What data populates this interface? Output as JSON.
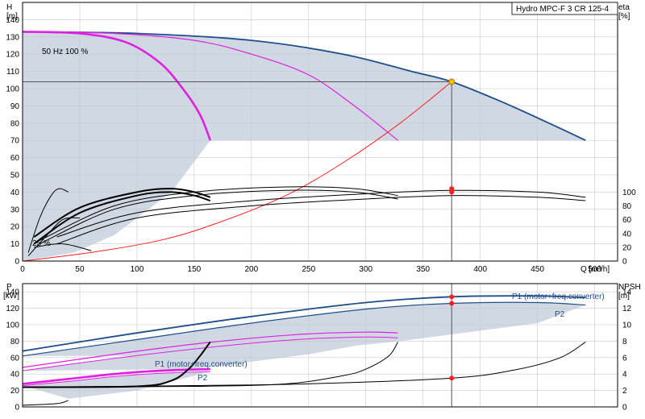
{
  "title": "Hydro MPC-F 3 CR 125-4",
  "colors": {
    "area_fill": "#cfd8e3",
    "grid": "#c8c8c8",
    "blue_curve": "#1f4e8c",
    "magenta": "#e020e0",
    "red": "#ff2020",
    "black": "#000000",
    "duty_point_fill": "#f5c000"
  },
  "chart_data": [
    {
      "id": "head-efficiency",
      "type": "line",
      "xlabel": "Q [m³/h]",
      "ylabel_left": "H\n[m]",
      "ylabel_right": "eta\n[%]",
      "xlim": [
        0,
        520
      ],
      "ylim_left": [
        0,
        150
      ],
      "ylim_right": [
        0,
        150
      ],
      "x_ticks": [
        0,
        50,
        100,
        150,
        200,
        250,
        300,
        350,
        400,
        450,
        500
      ],
      "y_ticks_left": [
        0,
        10,
        20,
        30,
        40,
        50,
        60,
        70,
        80,
        90,
        100,
        110,
        120,
        130,
        140
      ],
      "y_ticks_right": [
        0,
        20,
        40,
        60,
        80,
        100
      ],
      "annotations": [
        "50 Hz 100 %",
        "25 %"
      ],
      "duty_point": {
        "q": 375,
        "h": 104
      },
      "series": [
        {
          "key": "h3",
          "style": "blue",
          "points": [
            [
              0,
              133
            ],
            [
              100,
              132
            ],
            [
              200,
              128
            ],
            [
              280,
              120
            ],
            [
              340,
              110
            ],
            [
              375,
              104
            ],
            [
              420,
              92
            ],
            [
              460,
              80
            ],
            [
              492,
              70
            ]
          ]
        },
        {
          "key": "h2",
          "style": "magenta",
          "points": [
            [
              0,
              133
            ],
            [
              80,
              132
            ],
            [
              150,
              128
            ],
            [
              200,
              120
            ],
            [
              250,
              108
            ],
            [
              290,
              90
            ],
            [
              328,
              70
            ]
          ]
        },
        {
          "key": "h1",
          "style": "magenta_bold",
          "points": [
            [
              0,
              133
            ],
            [
              50,
              132
            ],
            [
              90,
              127
            ],
            [
              120,
              115
            ],
            [
              140,
              100
            ],
            [
              155,
              85
            ],
            [
              164,
              70
            ]
          ]
        },
        {
          "key": "system",
          "style": "red",
          "points": [
            [
              0,
              0
            ],
            [
              60,
              5
            ],
            [
              120,
              12
            ],
            [
              170,
              22
            ],
            [
              230,
              38
            ],
            [
              280,
              57
            ],
            [
              330,
              80
            ],
            [
              375,
              104
            ]
          ]
        },
        {
          "key": "eta3",
          "style": "black",
          "points": [
            [
              30,
              10
            ],
            [
              100,
              25
            ],
            [
              200,
              32
            ],
            [
              300,
              36
            ],
            [
              375,
              38
            ],
            [
              450,
              37
            ],
            [
              492,
              35
            ]
          ]
        },
        {
          "key": "eta3b",
          "style": "black",
          "points": [
            [
              30,
              14
            ],
            [
              100,
              28
            ],
            [
              200,
              35
            ],
            [
              300,
              39
            ],
            [
              375,
              41
            ],
            [
              450,
              40
            ],
            [
              492,
              37
            ]
          ]
        },
        {
          "key": "eta2",
          "style": "black",
          "points": [
            [
              15,
              10
            ],
            [
              80,
              30
            ],
            [
              150,
              38
            ],
            [
              230,
              41
            ],
            [
              290,
              40
            ],
            [
              328,
              36
            ]
          ]
        },
        {
          "key": "eta2b",
          "style": "black",
          "points": [
            [
              15,
              12
            ],
            [
              80,
              32
            ],
            [
              150,
              40
            ],
            [
              230,
              43
            ],
            [
              290,
              42
            ],
            [
              328,
              38
            ]
          ]
        },
        {
          "key": "eta1",
          "style": "black_bold",
          "points": [
            [
              10,
              10
            ],
            [
              50,
              28
            ],
            [
              100,
              38
            ],
            [
              130,
              40
            ],
            [
              150,
              38
            ],
            [
              164,
              35
            ]
          ]
        },
        {
          "key": "eta1b",
          "style": "black_bold",
          "points": [
            [
              10,
              14
            ],
            [
              50,
              31
            ],
            [
              100,
              40
            ],
            [
              130,
              42
            ],
            [
              150,
              40
            ],
            [
              164,
              37
            ]
          ]
        },
        {
          "key": "eta_small",
          "style": "black",
          "points": [
            [
              5,
              5
            ],
            [
              15,
              25
            ],
            [
              25,
              38
            ],
            [
              32,
              42
            ],
            [
              40,
              40
            ]
          ]
        },
        {
          "key": "eta_small2",
          "style": "black",
          "points": [
            [
              5,
              3
            ],
            [
              20,
              14
            ],
            [
              35,
              24
            ],
            [
              50,
              25
            ]
          ]
        },
        {
          "key": "eta_low",
          "style": "black",
          "points": [
            [
              10,
              8
            ],
            [
              35,
              10
            ],
            [
              60,
              6
            ]
          ]
        }
      ],
      "duty_marks": [
        {
          "q": 375,
          "eta": 80
        },
        {
          "q": 375,
          "eta": 84
        }
      ]
    },
    {
      "id": "power-npsh",
      "type": "line",
      "xlabel": "",
      "ylabel_left": "P\n[kW]",
      "ylabel_right": "NPSH\n[m]",
      "xlim": [
        0,
        520
      ],
      "ylim_left": [
        0,
        150
      ],
      "ylim_right": [
        0,
        15
      ],
      "y_ticks_left": [
        0,
        20,
        40,
        60,
        80,
        100,
        120,
        140
      ],
      "y_ticks_right": [
        0,
        2,
        4,
        6,
        8,
        10,
        12,
        14
      ],
      "legend_labels": [
        "P1 (motor+freq.converter)",
        "P2",
        "P1 (motor+freq.converter)",
        "P2"
      ],
      "series": [
        {
          "key": "p1_3",
          "style": "blue",
          "points": [
            [
              0,
              68
            ],
            [
              100,
              90
            ],
            [
              200,
              110
            ],
            [
              300,
              127
            ],
            [
              375,
              134
            ],
            [
              450,
              135
            ],
            [
              492,
              133
            ]
          ]
        },
        {
          "key": "p2_3",
          "style": "blue_thin",
          "points": [
            [
              0,
              62
            ],
            [
              100,
              82
            ],
            [
              200,
              102
            ],
            [
              300,
              119
            ],
            [
              375,
              126
            ],
            [
              450,
              127
            ],
            [
              492,
              124
            ]
          ]
        },
        {
          "key": "p1_2",
          "style": "magenta",
          "points": [
            [
              0,
              48
            ],
            [
              80,
              64
            ],
            [
              160,
              78
            ],
            [
              240,
              88
            ],
            [
              300,
              91
            ],
            [
              328,
              90
            ]
          ]
        },
        {
          "key": "p2_2",
          "style": "magenta_thin",
          "points": [
            [
              0,
              44
            ],
            [
              80,
              59
            ],
            [
              160,
              72
            ],
            [
              240,
              82
            ],
            [
              300,
              85
            ],
            [
              328,
              84
            ]
          ]
        },
        {
          "key": "p1_1",
          "style": "magenta_bold",
          "points": [
            [
              0,
              28
            ],
            [
              40,
              34
            ],
            [
              80,
              40
            ],
            [
              120,
              44
            ],
            [
              164,
              46
            ]
          ]
        },
        {
          "key": "p2_1",
          "style": "magenta_thin",
          "points": [
            [
              0,
              26
            ],
            [
              40,
              31
            ],
            [
              80,
              37
            ],
            [
              120,
              41
            ],
            [
              164,
              43
            ]
          ]
        },
        {
          "key": "npsh3",
          "style": "black",
          "points": [
            [
              0,
              2.4
            ],
            [
              150,
              2.6
            ],
            [
              250,
              2.8
            ],
            [
              375,
              3.5
            ],
            [
              430,
              4.5
            ],
            [
              470,
              6
            ],
            [
              492,
              7.9
            ]
          ]
        },
        {
          "key": "npsh2",
          "style": "black",
          "points": [
            [
              0,
              2.4
            ],
            [
              150,
              2.5
            ],
            [
              230,
              2.8
            ],
            [
              280,
              3.8
            ],
            [
              300,
              4.6
            ],
            [
              320,
              6.2
            ],
            [
              328,
              7.9
            ]
          ]
        },
        {
          "key": "npsh1",
          "style": "black_bold",
          "points": [
            [
              0,
              2.4
            ],
            [
              100,
              2.5
            ],
            [
              130,
              3.2
            ],
            [
              145,
              4.6
            ],
            [
              155,
              6.2
            ],
            [
              164,
              7.9
            ]
          ]
        },
        {
          "key": "npsh0",
          "style": "black",
          "points": [
            [
              0,
              0.2
            ],
            [
              30,
              0.4
            ],
            [
              40,
              0.8
            ]
          ]
        }
      ],
      "duty_marks": [
        {
          "q": 375,
          "p": 134
        },
        {
          "q": 375,
          "p": 126
        },
        {
          "q": 375,
          "p": 35
        }
      ]
    }
  ]
}
